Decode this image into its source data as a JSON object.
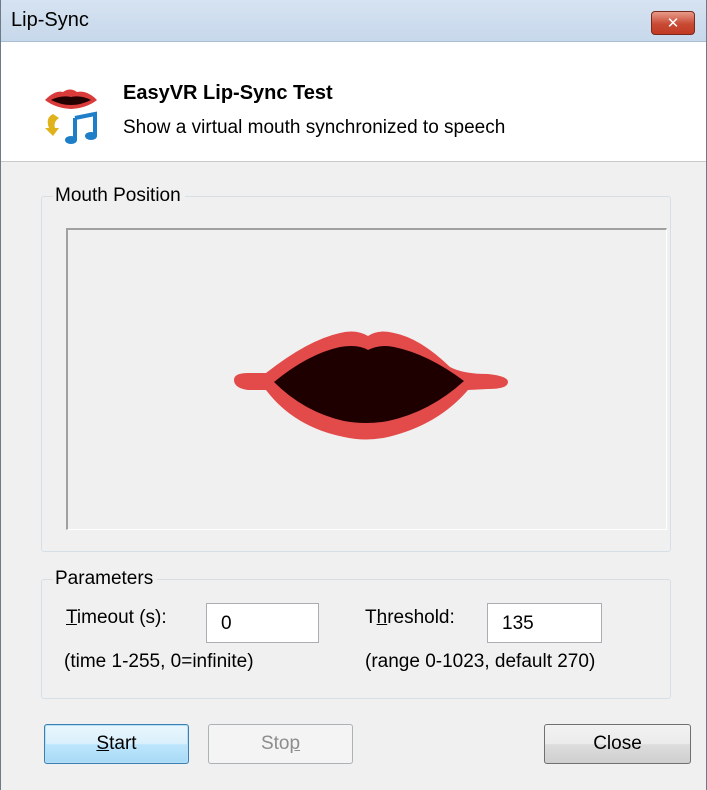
{
  "window": {
    "title": "Lip-Sync",
    "close_glyph": "✕"
  },
  "header": {
    "title": "EasyVR Lip-Sync Test",
    "subtitle": "Show a virtual mouth synchronized to speech",
    "icon": "lips-music-icon"
  },
  "mouth_group": {
    "label": "Mouth Position",
    "lip_color": "#e24b4a",
    "mouth_inner_color": "#1e0000"
  },
  "parameters": {
    "label": "Parameters",
    "timeout_label_mnemonic": "T",
    "timeout_label_rest": "imeout (s):",
    "timeout_value": "0",
    "timeout_hint": "(time 1-255, 0=infinite)",
    "threshold_label_pre": "T",
    "threshold_label_mnemonic": "h",
    "threshold_label_rest": "reshold:",
    "threshold_value": "135",
    "threshold_hint": "(range 0-1023, default 270)"
  },
  "buttons": {
    "start_mnemonic": "S",
    "start_rest": "tart",
    "stop_pre": "Sto",
    "stop_mnemonic": "p",
    "close": "Close"
  }
}
